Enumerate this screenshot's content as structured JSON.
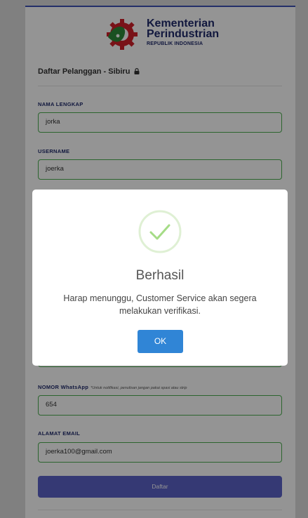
{
  "logo": {
    "line1": "Kementerian",
    "line2": "Perindustrian",
    "line3": "REPUBLIK INDONESIA"
  },
  "page_title": "Daftar Pelanggan - Sibiru",
  "form": {
    "nama": {
      "label": "NAMA LENGKAP",
      "value": "jorka"
    },
    "username": {
      "label": "USERNAME",
      "value": "joerka"
    },
    "whatsapp": {
      "label": "NOMOR WhatsApp",
      "note": "*Untuk notifikasi, penulisan jangan pakai spasi atau strip",
      "value": "654"
    },
    "email": {
      "label": "ALAMAT EMAIL",
      "value": "joerka100@gmail.com"
    },
    "submit_label": "Daftar"
  },
  "modal": {
    "title": "Berhasil",
    "message": "Harap menunggu, Customer Service akan segera melakukan verifikasi.",
    "ok_label": "OK",
    "icon": "success-check-icon"
  },
  "colors": {
    "accent": "#3f51b5",
    "field_border": "#4caf50",
    "submit": "#5c62c9",
    "ok_button": "#3085d6",
    "success": "#a5dc86",
    "logo_red": "#d0202a",
    "logo_green": "#2e8b3a",
    "logo_text": "#1f2a6b"
  }
}
